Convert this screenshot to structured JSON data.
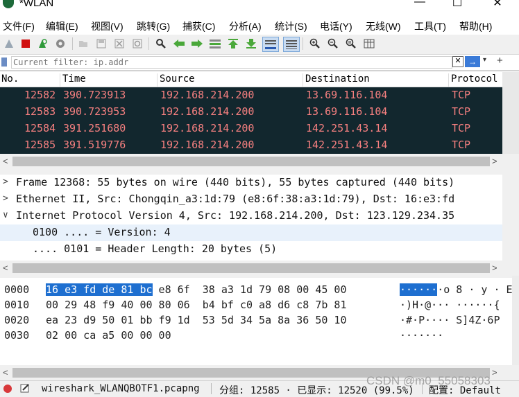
{
  "window": {
    "title": "*WLAN",
    "minimize": "—",
    "maximize": "☐",
    "close": "✕"
  },
  "menu": [
    "文件(F)",
    "编辑(E)",
    "视图(V)",
    "跳转(G)",
    "捕获(C)",
    "分析(A)",
    "统计(S)",
    "电话(Y)",
    "无线(W)",
    "工具(T)",
    "帮助(H)"
  ],
  "toolbar": {
    "icons": [
      "shark-fin-icon",
      "stop-icon",
      "restart-icon",
      "options-gear-icon",
      "open-file-icon",
      "save-file-icon",
      "close-file-icon",
      "reload-icon",
      "find-icon",
      "back-arrow-icon",
      "forward-arrow-icon",
      "goto-packet-icon",
      "first-packet-icon",
      "last-packet-icon",
      "autoscroll-icon",
      "colorize-icon",
      "zoom-in-icon",
      "zoom-out-icon",
      "zoom-normal-icon",
      "resize-columns-icon"
    ]
  },
  "filter": {
    "placeholder": "Current filter: ip.addr",
    "value": "",
    "apply_label": "→"
  },
  "packet_list": {
    "columns": [
      "No.",
      "Time",
      "Source",
      "Destination",
      "Protocol"
    ],
    "rows": [
      {
        "no": "12582",
        "time": "390.723913",
        "source": "192.168.214.200",
        "destination": "13.69.116.104",
        "protocol": "TCP"
      },
      {
        "no": "12583",
        "time": "390.723953",
        "source": "192.168.214.200",
        "destination": "13.69.116.104",
        "protocol": "TCP"
      },
      {
        "no": "12584",
        "time": "391.251680",
        "source": "192.168.214.200",
        "destination": "142.251.43.14",
        "protocol": "TCP"
      },
      {
        "no": "12585",
        "time": "391.519776",
        "source": "192.168.214.200",
        "destination": "142.251.43.14",
        "protocol": "TCP"
      }
    ],
    "row_bg": "#12272e",
    "row_fg": "#f78080"
  },
  "details": [
    {
      "arrow": ">",
      "text": "Frame 12368: 55 bytes on wire (440 bits), 55 bytes captured (440 bits)"
    },
    {
      "arrow": ">",
      "text": "Ethernet II, Src: Chongqin_a3:1d:79 (e8:6f:38:a3:1d:79), Dst: 16:e3:fd"
    },
    {
      "arrow": "∨",
      "text": "Internet Protocol Version 4, Src: 192.168.214.200, Dst: 123.129.234.35"
    },
    {
      "arrow": "",
      "text": "0100 .... = Version: 4"
    },
    {
      "arrow": "",
      "text": ".... 0101 = Header Length: 20 bytes (5)"
    }
  ],
  "bytes": {
    "offsets": [
      "0000",
      "0010",
      "0020",
      "0030"
    ],
    "hex": [
      {
        "sel": "16 e3 fd de 81 bc",
        "rest": " e8 6f  38 a3 1d 79 08 00 45 00"
      },
      {
        "sel": "",
        "rest": "00 29 48 f9 40 00 80 06  b4 bf c0 a8 d6 c8 7b 81"
      },
      {
        "sel": "",
        "rest": "ea 23 d9 50 01 bb f9 1d  53 5d 34 5a 8a 36 50 10"
      },
      {
        "sel": "",
        "rest": "02 00 ca a5 00 00 00"
      }
    ],
    "ascii": [
      {
        "sel": "······",
        "rest": "·o 8 · y · E"
      },
      {
        "sel": "",
        "rest": "·)H·@··· ······{"
      },
      {
        "sel": "",
        "rest": "·#·P···· S]4Z·6P"
      },
      {
        "sel": "",
        "rest": "·······"
      }
    ]
  },
  "status": {
    "file": "wireshark_WLANQBOTF1.pcapng",
    "packets": "分组: 12585 · 已显示: 12520 (99.5%)",
    "profile": "配置: Default"
  },
  "watermark": "CSDN @m0_55058303",
  "colors": {
    "selection": "#1e6fd0",
    "row_background": "#12272e",
    "row_text": "#f78080"
  }
}
